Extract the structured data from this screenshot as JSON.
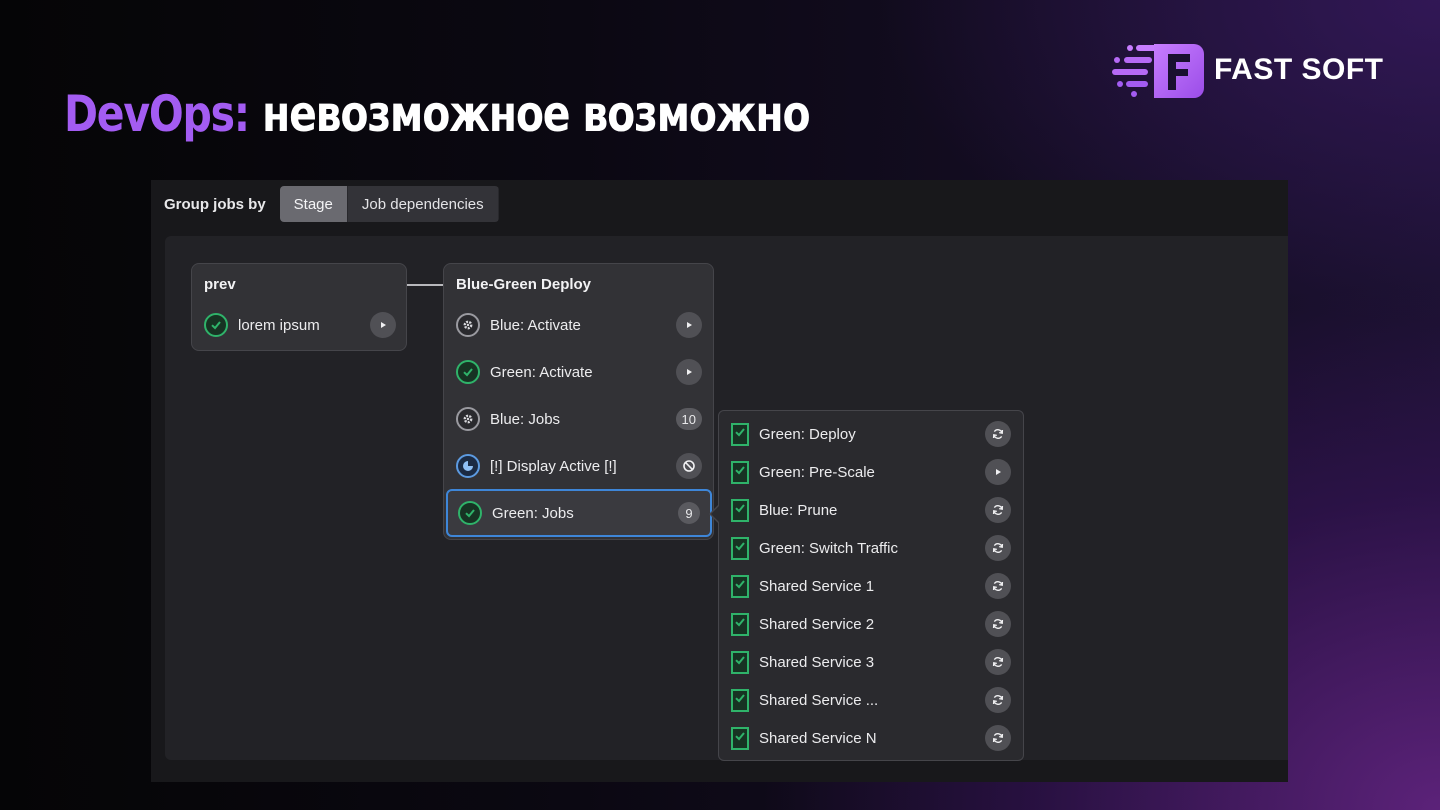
{
  "slide": {
    "title_accent": "DevOps:",
    "title_rest": " невозможное возможно",
    "brand_name": "FAST SOFT",
    "brand_color": "#a35cf2"
  },
  "toolbar": {
    "label": "Group jobs by",
    "options": [
      "Stage",
      "Job dependencies"
    ],
    "active": "Stage"
  },
  "stages": {
    "prev": {
      "title": "prev",
      "jobs": [
        {
          "label": "lorem ipsum",
          "status": "success",
          "action": "play-icon"
        }
      ]
    },
    "deploy": {
      "title": "Blue-Green Deploy",
      "jobs": [
        {
          "label": "Blue: Activate",
          "status": "manual",
          "action": "play-icon"
        },
        {
          "label": "Green: Activate",
          "status": "success",
          "action": "play-icon"
        },
        {
          "label": "Blue: Jobs",
          "status": "manual",
          "count": "10"
        },
        {
          "label": "[!] Display Active [!]",
          "status": "created",
          "action": "cancel-icon"
        },
        {
          "label": "Green: Jobs",
          "status": "success",
          "count": "9",
          "selected": true
        }
      ]
    }
  },
  "dropdown": {
    "jobs": [
      {
        "label": "Green: Deploy",
        "status": "success",
        "action": "retry-icon"
      },
      {
        "label": "Green: Pre-Scale",
        "status": "success",
        "action": "play-icon"
      },
      {
        "label": "Blue: Prune",
        "status": "success",
        "action": "retry-icon"
      },
      {
        "label": "Green: Switch Traffic",
        "status": "success",
        "action": "retry-icon"
      },
      {
        "label": "Shared Service 1",
        "status": "success",
        "action": "retry-icon"
      },
      {
        "label": "Shared Service 2",
        "status": "success",
        "action": "retry-icon"
      },
      {
        "label": "Shared Service 3",
        "status": "success",
        "action": "retry-icon"
      },
      {
        "label": "Shared Service ...",
        "status": "success",
        "action": "retry-icon"
      },
      {
        "label": "Shared Service N",
        "status": "success",
        "action": "retry-icon"
      }
    ]
  },
  "colors": {
    "success": "#2fb36a",
    "manual": "#9a9aa0",
    "created": "#5c9ae0",
    "selected_border": "#3e86d8"
  }
}
